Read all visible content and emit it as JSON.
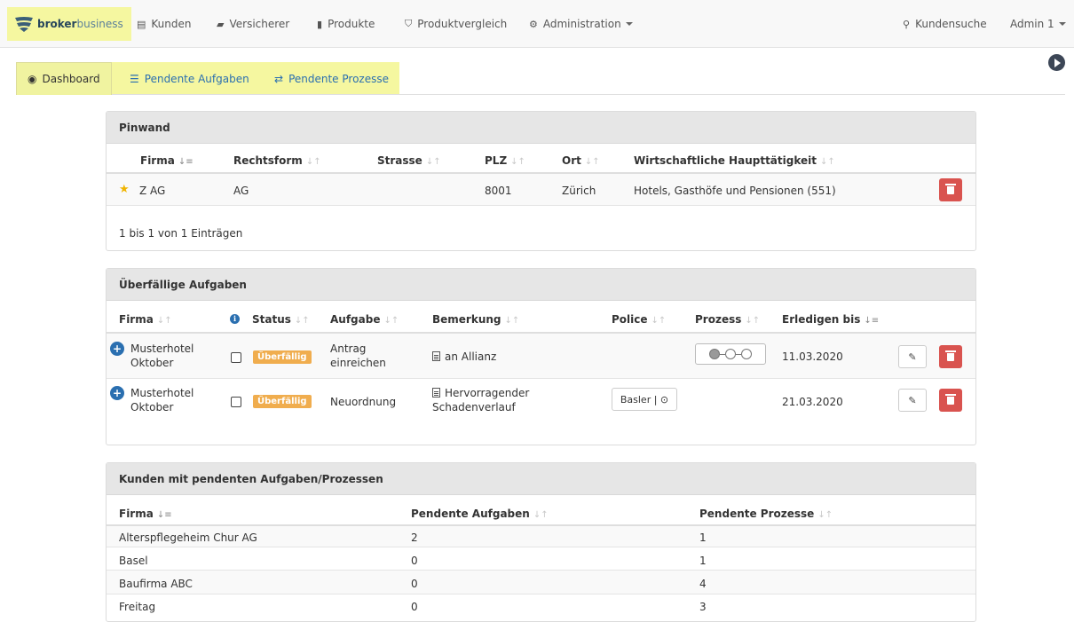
{
  "brand": {
    "bold": "broker",
    "rest": "business"
  },
  "nav": {
    "kunden": "Kunden",
    "versicherer": "Versicherer",
    "produkte": "Produkte",
    "produktvergleich": "Produktvergleich",
    "administration": "Administration",
    "kundensuche": "Kundensuche",
    "user": "Admin 1"
  },
  "tabs": {
    "dashboard": "Dashboard",
    "aufgaben": "Pendente Aufgaben",
    "prozesse": "Pendente Prozesse"
  },
  "pinwand": {
    "title": "Pinwand",
    "headers": {
      "firma": "Firma",
      "rechtsform": "Rechtsform",
      "strasse": "Strasse",
      "plz": "PLZ",
      "ort": "Ort",
      "taetigkeit": "Wirtschaftliche Haupttätigkeit"
    },
    "row": {
      "firma": "Z AG",
      "rechtsform": "AG",
      "strasse": "",
      "plz": "8001",
      "ort": "Zürich",
      "taetigkeit": "Hotels, Gasthöfe und Pensionen (551)"
    },
    "footer": "1 bis 1 von 1 Einträgen"
  },
  "overdue": {
    "title": "Überfällige Aufgaben",
    "headers": {
      "firma": "Firma",
      "status": "Status",
      "aufgabe": "Aufgabe",
      "bemerkung": "Bemerkung",
      "police": "Police",
      "prozess": "Prozess",
      "erledigen": "Erledigen bis"
    },
    "rows": [
      {
        "firma": "Musterhotel Oktober",
        "status": "Überfällig",
        "aufgabe": "Antrag einreichen",
        "bemerkung": "an Allianz",
        "police": "",
        "erledigen": "11.03.2020"
      },
      {
        "firma": "Musterhotel Oktober",
        "status": "Überfällig",
        "aufgabe": "Neuordnung",
        "bemerkung": "Hervorragender Schadenverlauf",
        "police": "Basler | ⊙",
        "erledigen": "21.03.2020"
      }
    ]
  },
  "kunden": {
    "title": "Kunden mit pendenten Aufgaben/Prozessen",
    "headers": {
      "firma": "Firma",
      "aufgaben": "Pendente Aufgaben",
      "prozesse": "Pendente Prozesse"
    },
    "rows": [
      {
        "firma": "Alterspflegeheim Chur AG",
        "aufgaben": "2",
        "prozesse": "1"
      },
      {
        "firma": "Basel",
        "aufgaben": "0",
        "prozesse": "1"
      },
      {
        "firma": "Baufirma ABC",
        "aufgaben": "0",
        "prozesse": "4"
      },
      {
        "firma": "Freitag",
        "aufgaben": "0",
        "prozesse": "3"
      }
    ]
  }
}
